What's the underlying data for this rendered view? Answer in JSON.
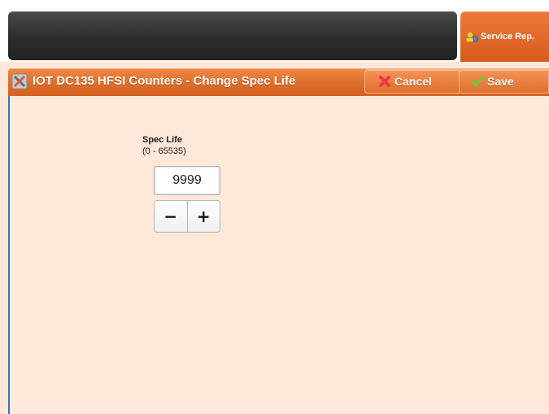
{
  "header": {
    "service_tab_label": "Service Rep.",
    "service_icon": "service-rep-icon"
  },
  "dialog": {
    "title": "IOT DC135 HFSI Counters - Change Spec Life",
    "title_icon": "tools-icon",
    "cancel_label": "Cancel",
    "cancel_icon": "cancel-x-icon",
    "save_label": "Save",
    "save_icon": "checkmark-icon"
  },
  "field": {
    "label": "Spec Life",
    "range": "(0 - 65535)",
    "value": "9999",
    "decrement_label": "−",
    "increment_label": "+"
  },
  "colors": {
    "accent_orange": "#e0702c",
    "background": "#fde8da",
    "topbar_dark": "#2d2d2d",
    "cancel_icon_red": "#e83a4a",
    "save_icon_green": "#6cc93a"
  }
}
